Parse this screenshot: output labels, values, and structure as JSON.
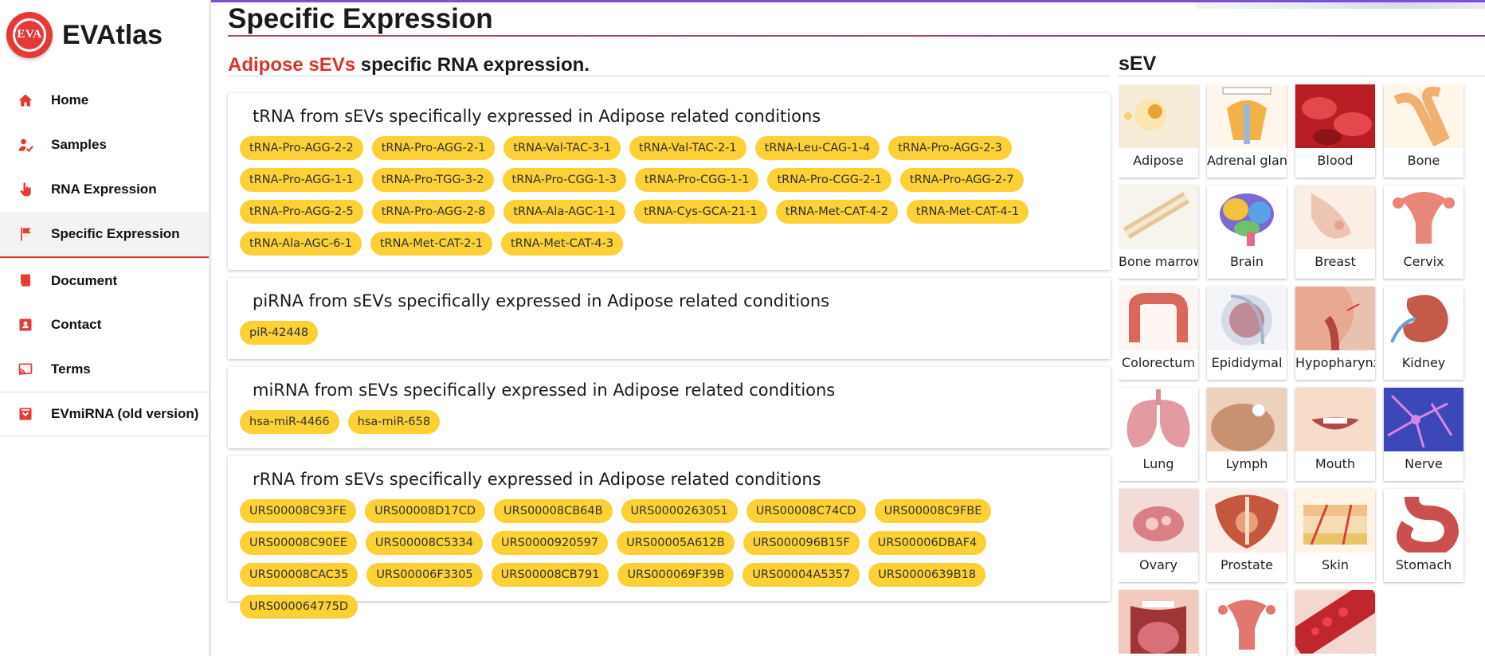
{
  "app": {
    "logo_text": "EVA",
    "name": "EVAtlas"
  },
  "nav": [
    {
      "label": "Home",
      "icon": "home-icon"
    },
    {
      "label": "Samples",
      "icon": "samples-icon"
    },
    {
      "label": "RNA Expression",
      "icon": "hand-pointer-icon"
    },
    {
      "label": "Specific Expression",
      "icon": "flag-icon",
      "active": true
    },
    {
      "label": "Document",
      "icon": "book-icon"
    },
    {
      "label": "Contact",
      "icon": "contact-card-icon"
    },
    {
      "label": "Terms",
      "icon": "cast-icon"
    },
    {
      "label": "EVmiRNA (old version)",
      "icon": "download-box-icon"
    }
  ],
  "page": {
    "title": "Specific Expression",
    "section_highlight": "Adipose sEVs",
    "section_rest": " specific RNA expression."
  },
  "cards": [
    {
      "title": "tRNA from sEVs specifically expressed in Adipose related conditions",
      "chips": [
        "tRNA-Pro-AGG-2-2",
        "tRNA-Pro-AGG-2-1",
        "tRNA-Val-TAC-3-1",
        "tRNA-Val-TAC-2-1",
        "tRNA-Leu-CAG-1-4",
        "tRNA-Pro-AGG-2-3",
        "tRNA-Pro-AGG-1-1",
        "tRNA-Pro-TGG-3-2",
        "tRNA-Pro-CGG-1-3",
        "tRNA-Pro-CGG-1-1",
        "tRNA-Pro-CGG-2-1",
        "tRNA-Pro-AGG-2-7",
        "tRNA-Pro-AGG-2-5",
        "tRNA-Pro-AGG-2-8",
        "tRNA-Ala-AGC-1-1",
        "tRNA-Cys-GCA-21-1",
        "tRNA-Met-CAT-4-2",
        "tRNA-Met-CAT-4-1",
        "tRNA-Ala-AGC-6-1",
        "tRNA-Met-CAT-2-1",
        "tRNA-Met-CAT-4-3"
      ]
    },
    {
      "title": "piRNA from sEVs specifically expressed in Adipose related conditions",
      "chips": [
        "piR-42448"
      ]
    },
    {
      "title": "miRNA from sEVs specifically expressed in Adipose related conditions",
      "chips": [
        "hsa-miR-4466",
        "hsa-miR-658"
      ]
    },
    {
      "title": "rRNA from sEVs specifically expressed in Adipose related conditions",
      "chips": [
        "URS00008C93FE",
        "URS00008D17CD",
        "URS00008CB64B",
        "URS0000263051",
        "URS00008C74CD",
        "URS00008C9FBE",
        "URS00008C90EE",
        "URS00008C5334",
        "URS0000920597",
        "URS00005A612B",
        "URS000096B15F",
        "URS00006DBAF4",
        "URS00008CAC35",
        "URS00006F3305",
        "URS00008CB791",
        "URS000069F39B",
        "URS00004A5357",
        "URS0000639B18",
        "URS000064775D"
      ]
    }
  ],
  "sev": {
    "title": "sEV",
    "tiles": [
      {
        "label": "Adipose",
        "icon": "adipose-icon",
        "bg": "#f6ecd8",
        "fg": "#e8a23a"
      },
      {
        "label": "Adrenal gland",
        "icon": "adrenal-gland-icon",
        "bg": "#fff7ec",
        "fg": "#f2b24a"
      },
      {
        "label": "Blood",
        "icon": "blood-icon",
        "bg": "#b81d24",
        "fg": "#e2484c"
      },
      {
        "label": "Bone",
        "icon": "bone-icon",
        "bg": "#fff6ea",
        "fg": "#f0b070"
      },
      {
        "label": "Bone marrow",
        "icon": "bone-marrow-icon",
        "bg": "#f7f4ee",
        "fg": "#e6c79a"
      },
      {
        "label": "Brain",
        "icon": "brain-icon",
        "bg": "#ffffff",
        "fg": "#7c6ad0"
      },
      {
        "label": "Breast",
        "icon": "breast-icon",
        "bg": "#fbeee4",
        "fg": "#eec4b2"
      },
      {
        "label": "Cervix",
        "icon": "cervix-icon",
        "bg": "#ffffff",
        "fg": "#e8867a"
      },
      {
        "label": "Colorectum",
        "icon": "colorectum-icon",
        "bg": "#fff6f4",
        "fg": "#d8675c"
      },
      {
        "label": "Epididymal",
        "icon": "epididymal-icon",
        "bg": "#f3f5f9",
        "fg": "#c08a96"
      },
      {
        "label": "Hypopharynx",
        "icon": "hypopharynx-icon",
        "bg": "#e9c1b0",
        "fg": "#b0463e"
      },
      {
        "label": "Kidney",
        "icon": "kidney-icon",
        "bg": "#ffffff",
        "fg": "#c45a4a"
      },
      {
        "label": "Lung",
        "icon": "lung-icon",
        "bg": "#ffffff",
        "fg": "#e39aa0"
      },
      {
        "label": "Lymph",
        "icon": "lymph-icon",
        "bg": "#ecd1bd",
        "fg": "#c89272"
      },
      {
        "label": "Mouth",
        "icon": "mouth-icon",
        "bg": "#f6dcc9",
        "fg": "#b14a4a"
      },
      {
        "label": "Nerve",
        "icon": "nerve-icon",
        "bg": "#3c47b8",
        "fg": "#d985e8"
      },
      {
        "label": "Ovary",
        "icon": "ovary-icon",
        "bg": "#f3dcd8",
        "fg": "#d97f86"
      },
      {
        "label": "Prostate",
        "icon": "prostate-icon",
        "bg": "#fbeee8",
        "fg": "#c4573e"
      },
      {
        "label": "Skin",
        "icon": "skin-icon",
        "bg": "#fff4e6",
        "fg": "#e8a060"
      },
      {
        "label": "Stomach",
        "icon": "stomach-icon",
        "bg": "#ffffff",
        "fg": "#c9504e"
      },
      {
        "label": "",
        "icon": "tongue-icon",
        "bg": "#f1c9bd",
        "fg": "#d8707a"
      },
      {
        "label": "",
        "icon": "uterus-icon",
        "bg": "#ffffff",
        "fg": "#e07870"
      },
      {
        "label": "",
        "icon": "vessel-icon",
        "bg": "#f4d7cf",
        "fg": "#c0262e"
      }
    ]
  }
}
